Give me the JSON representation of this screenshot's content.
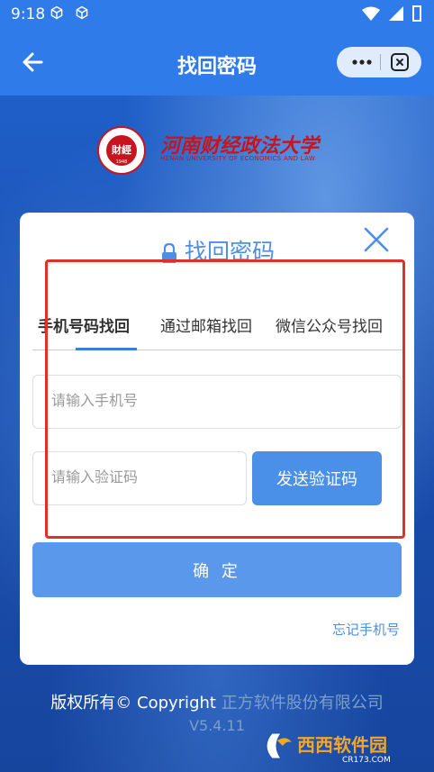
{
  "status_bar": {
    "time": "9:18"
  },
  "header": {
    "title": "找回密码"
  },
  "logo": {
    "school_name": "河南财经政法大学",
    "school_name_en": "HENAN UNIVERSITY OF ECONOMICS AND LAW",
    "seal_text": "財經",
    "seal_year": "1948"
  },
  "card": {
    "title": "找回密码",
    "tabs": [
      {
        "label": "手机号码找回",
        "active": true
      },
      {
        "label": "通过邮箱找回",
        "active": false
      },
      {
        "label": "微信公众号找回",
        "active": false
      }
    ],
    "phone_placeholder": "请输入手机号",
    "code_placeholder": "请输入验证码",
    "send_code_label": "发送验证码",
    "confirm_label": "确 定",
    "forgot_phone_label": "忘记手机号"
  },
  "footer": {
    "copyright_prefix": "版权所有© Copyright",
    "company": "正方软件股份有限公司",
    "version": "V5.4.11"
  },
  "watermark": {
    "brand": "西西软件园",
    "site": "CR173.COM"
  },
  "colors": {
    "header_bg": "#2f7bea",
    "accent": "#4a8fe8",
    "highlight_border": "#e0302a",
    "school_red": "#c8141e"
  }
}
